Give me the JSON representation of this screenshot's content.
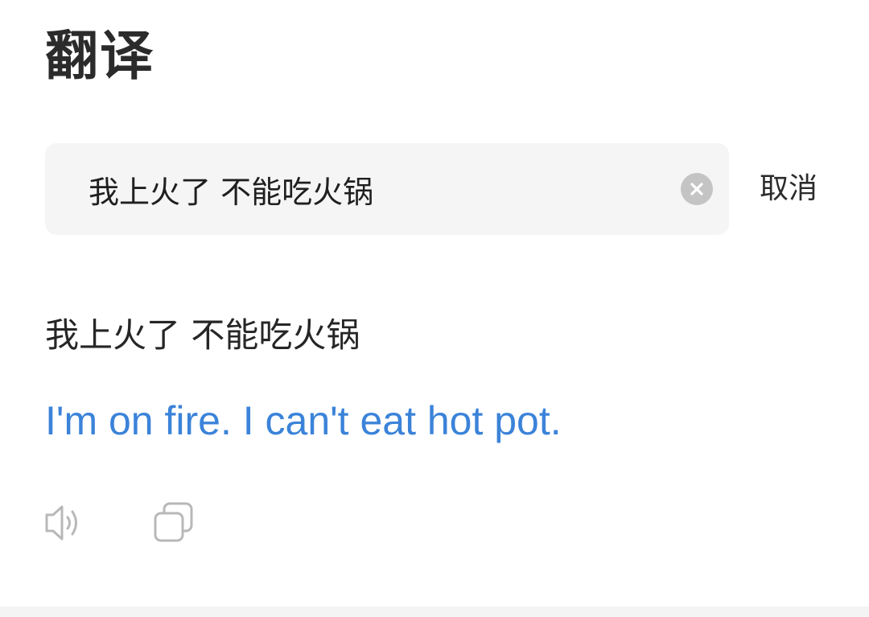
{
  "header": {
    "title": "翻译"
  },
  "search": {
    "value": "我上火了 不能吃火锅",
    "clear_icon": "clear-circle-icon",
    "cancel_label": "取消"
  },
  "result": {
    "source_text": "我上火了 不能吃火锅",
    "translation": "I'm on fire. I can't eat hot pot.",
    "translation_color": "#3b83d9"
  },
  "actions": {
    "speak_icon": "speaker-icon",
    "copy_icon": "copy-icon"
  }
}
